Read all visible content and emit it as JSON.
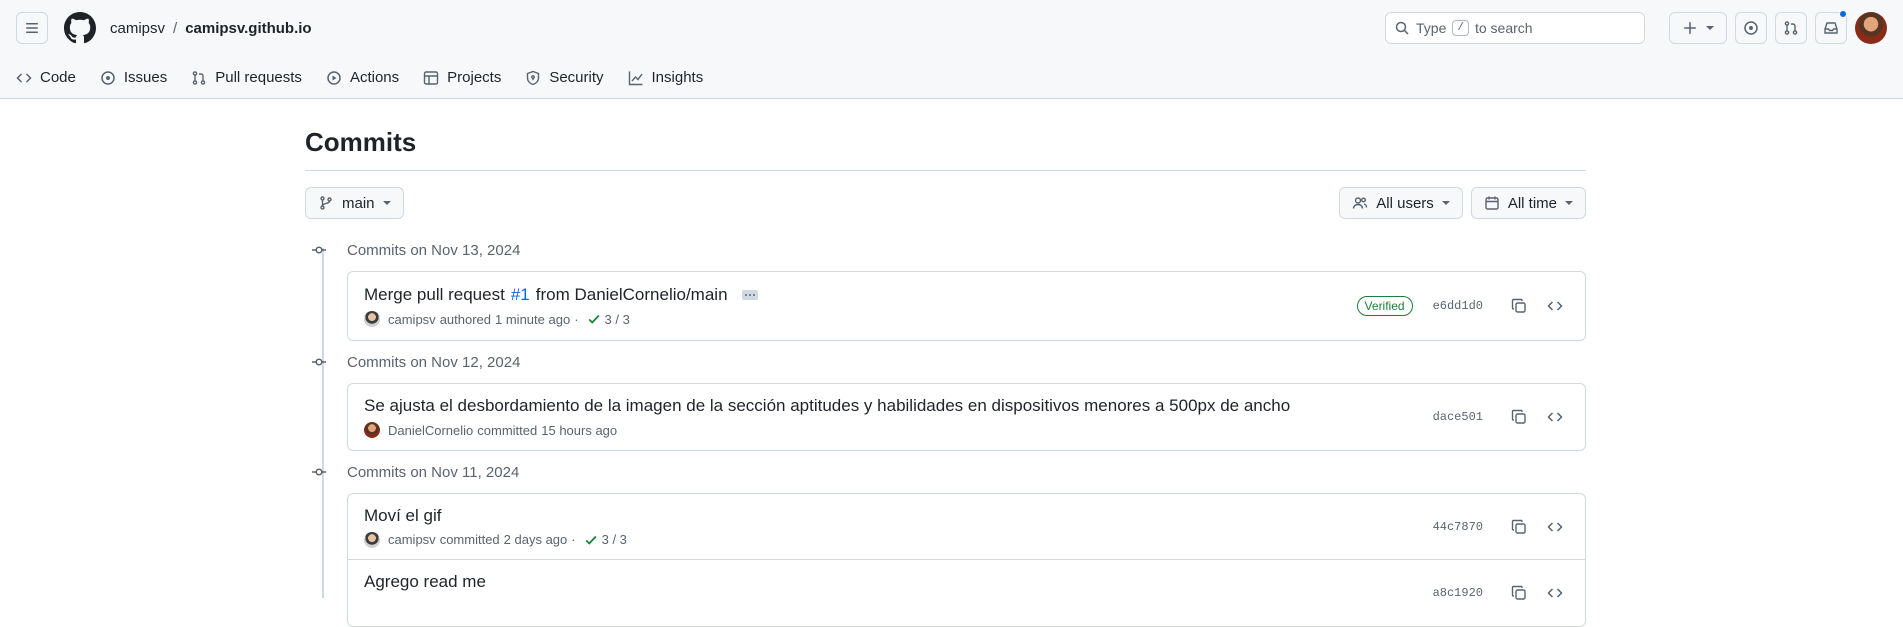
{
  "header": {
    "owner": "camipsv",
    "separator": "/",
    "repo": "camipsv.github.io",
    "search_prefix": "Type",
    "search_key": "/",
    "search_suffix": "to search"
  },
  "tabs": [
    {
      "label": "Code",
      "icon": "code-icon"
    },
    {
      "label": "Issues",
      "icon": "issue-icon"
    },
    {
      "label": "Pull requests",
      "icon": "pull-request-icon"
    },
    {
      "label": "Actions",
      "icon": "play-icon"
    },
    {
      "label": "Projects",
      "icon": "table-icon"
    },
    {
      "label": "Security",
      "icon": "shield-icon"
    },
    {
      "label": "Insights",
      "icon": "graph-icon"
    }
  ],
  "page": {
    "title": "Commits",
    "branch": "main",
    "users_filter": "All users",
    "time_filter": "All time"
  },
  "groups": [
    {
      "date_label": "Commits on Nov 13, 2024",
      "commits": [
        {
          "title_prefix": "Merge pull request",
          "link": "#1",
          "title_suffix": "from DanielCornelio/main",
          "author": "camipsv",
          "action": "authored",
          "time": "1 minute ago",
          "separator": "·",
          "checks": "3 / 3",
          "verified": "Verified",
          "sha": "e6dd1d0"
        }
      ]
    },
    {
      "date_label": "Commits on Nov 12, 2024",
      "commits": [
        {
          "title": "Se ajusta el desbordamiento de la imagen de la sección aptitudes y habilidades en dispositivos menores a 500px de ancho",
          "author": "DanielCornelio",
          "action": "committed",
          "time": "15 hours ago",
          "sha": "dace501"
        }
      ]
    },
    {
      "date_label": "Commits on Nov 11, 2024",
      "commits": [
        {
          "title": "Moví el gif",
          "author": "camipsv",
          "action": "committed",
          "time": "2 days ago",
          "separator": "·",
          "checks": "3 / 3",
          "sha": "44c7870"
        },
        {
          "title": "Agrego read me",
          "sha": "a8c1920"
        }
      ]
    }
  ],
  "colors": {
    "accent": "#0969da",
    "success": "#1a7f37",
    "border": "#d1d9e0"
  }
}
